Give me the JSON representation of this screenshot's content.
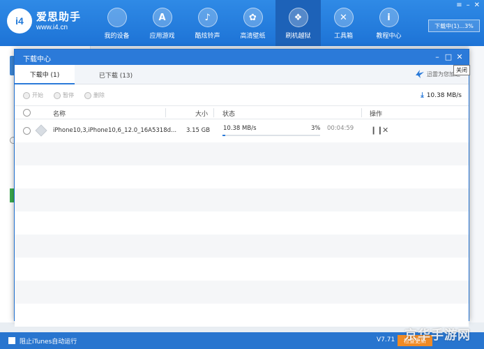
{
  "app": {
    "logo_text": "i4",
    "brand": "爱思助手",
    "site": "www.i4.cn",
    "nav": [
      {
        "label": "我的设备",
        "icon": "apple-icon",
        "glyph": ""
      },
      {
        "label": "应用游戏",
        "icon": "app-store-icon",
        "glyph": "A"
      },
      {
        "label": "酷炫铃声",
        "icon": "bell-icon",
        "glyph": "♪"
      },
      {
        "label": "高清壁纸",
        "icon": "flower-icon",
        "glyph": "✿"
      },
      {
        "label": "刷机越狱",
        "icon": "box-icon",
        "glyph": "❖"
      },
      {
        "label": "工具箱",
        "icon": "tools-icon",
        "glyph": "✕"
      },
      {
        "label": "教程中心",
        "icon": "info-icon",
        "glyph": "i"
      }
    ],
    "active_nav": "刷机越狱",
    "window_controls": [
      "≡",
      "–",
      "✕"
    ],
    "download_status": "下载中(1)...3%"
  },
  "dialog": {
    "title": "下载中心",
    "controls": {
      "min": "–",
      "max": "□",
      "close": "✕"
    },
    "tooltip": "关闭",
    "tabs": [
      {
        "label": "下载中 (1)",
        "active": true
      },
      {
        "label": "已下载 (13)",
        "active": false
      }
    ],
    "xunlei": "迅雷为您加速",
    "toolbar": {
      "start": "开始",
      "pause": "暂停",
      "delete": "删除"
    },
    "total_speed": "10.38 MB/s",
    "columns": {
      "name": "名称",
      "size": "大小",
      "status": "状态",
      "action": "操作"
    },
    "downloads": [
      {
        "name": "iPhone10,3,iPhone10,6_12.0_16A5318d...",
        "size": "3.15 GB",
        "speed": "10.38 MB/s",
        "percent": "3%",
        "progress": 0.03,
        "time": "00:04:59",
        "pause_icon": "pause-icon",
        "cancel_icon": "close-icon"
      }
    ]
  },
  "bottom": {
    "itunes_label": "阻止iTunes自动运行",
    "version": "V7.71",
    "update": "检查更新"
  },
  "watermark": "京华手游网",
  "colors": {
    "accent": "#2b7ad9",
    "topbar": "#1d73d6",
    "active_nav": "#1d62b8",
    "update_button": "#f08a24"
  }
}
